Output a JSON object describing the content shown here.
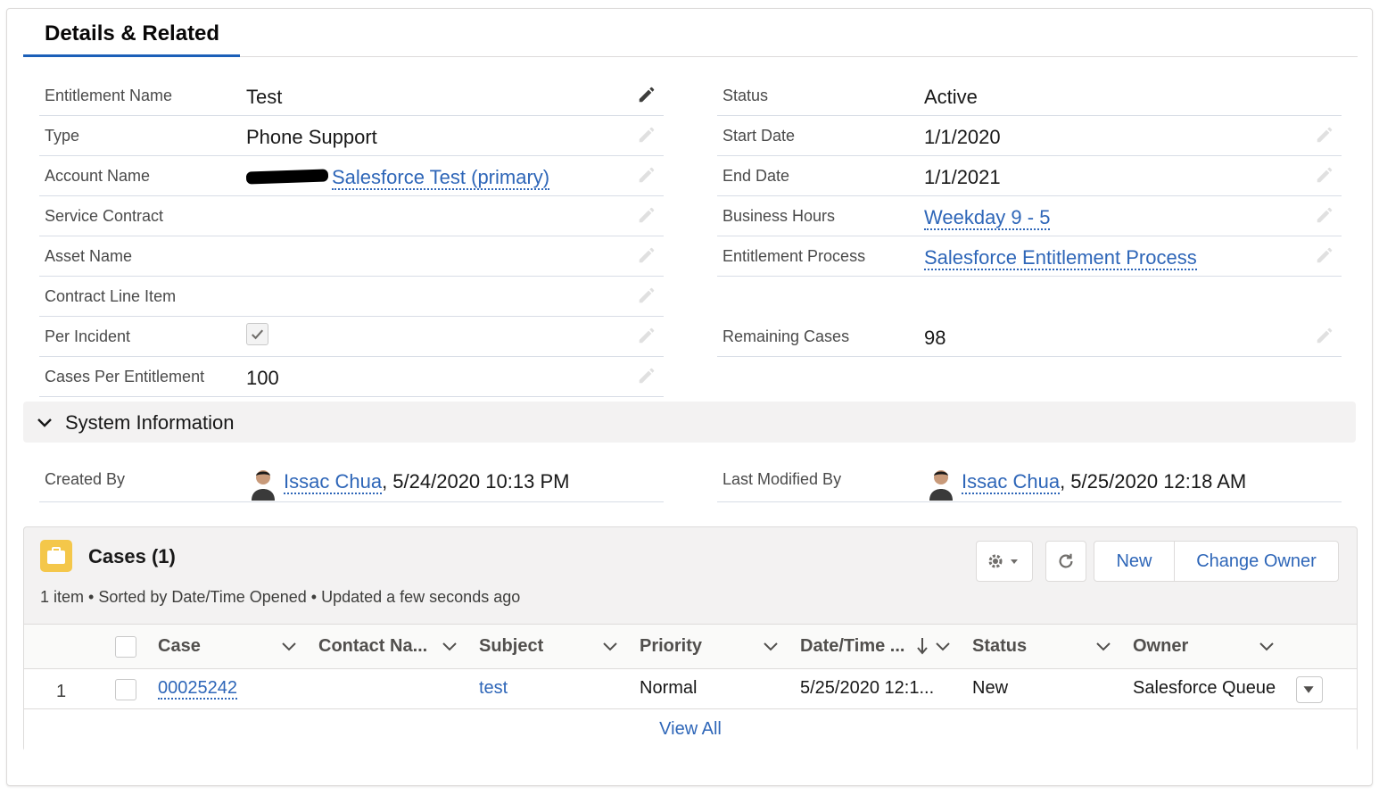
{
  "tab": {
    "label": "Details & Related"
  },
  "details_left": [
    {
      "label": "Entitlement Name",
      "value": "Test"
    },
    {
      "label": "Type",
      "value": "Phone Support"
    },
    {
      "label": "Account Name",
      "value": "Salesforce Test (primary)"
    },
    {
      "label": "Service Contract",
      "value": ""
    },
    {
      "label": "Asset Name",
      "value": ""
    },
    {
      "label": "Contract Line Item",
      "value": ""
    },
    {
      "label": "Per Incident",
      "value": ""
    },
    {
      "label": "Cases Per Entitlement",
      "value": "100"
    }
  ],
  "details_right": [
    {
      "label": "Status",
      "value": "Active"
    },
    {
      "label": "Start Date",
      "value": "1/1/2020"
    },
    {
      "label": "End Date",
      "value": "1/1/2021"
    },
    {
      "label": "Business Hours",
      "value": "Weekday 9 - 5"
    },
    {
      "label": "Entitlement Process",
      "value": "Salesforce Entitlement Process"
    },
    {
      "label": "",
      "value": ""
    },
    {
      "label": "Remaining Cases",
      "value": "98"
    }
  ],
  "system_info": {
    "title": "System Information",
    "created_by": {
      "label": "Created By",
      "user": "Issac Chua",
      "timestamp": ", 5/24/2020 10:13 PM"
    },
    "last_modified_by": {
      "label": "Last Modified By",
      "user": "Issac Chua",
      "timestamp": ", 5/25/2020 12:18 AM"
    }
  },
  "cases": {
    "title": "Cases (1)",
    "subtitle": "1 item • Sorted by Date/Time Opened • Updated a few seconds ago",
    "buttons": {
      "new": "New",
      "change_owner": "Change Owner"
    },
    "columns": [
      "Case",
      "Contact Na...",
      "Subject",
      "Priority",
      "Date/Time ...",
      "Status",
      "Owner"
    ],
    "rows": [
      {
        "num": "1",
        "case": "00025242",
        "contact": "",
        "subject": "test",
        "priority": "Normal",
        "datetime": "5/25/2020 12:1...",
        "status": "New",
        "owner": "Salesforce Queue"
      }
    ],
    "view_all": "View All"
  },
  "colors": {
    "accent": "#1b5fb8",
    "link": "#2e66b8",
    "case_icon": "#f4c74a"
  }
}
